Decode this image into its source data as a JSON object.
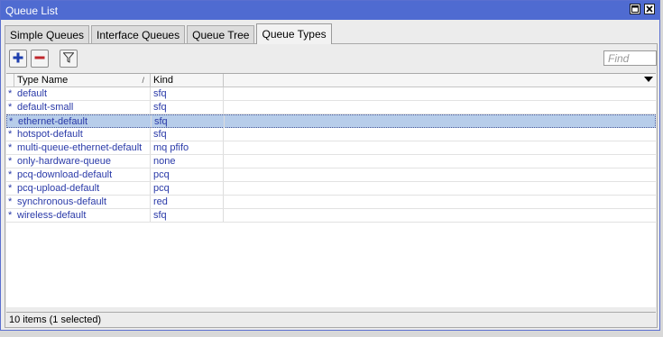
{
  "window": {
    "title": "Queue List"
  },
  "tabs": [
    {
      "label": "Simple Queues",
      "active": false
    },
    {
      "label": "Interface Queues",
      "active": false
    },
    {
      "label": "Queue Tree",
      "active": false
    },
    {
      "label": "Queue Types",
      "active": true
    }
  ],
  "toolbar": {
    "add_icon": "plus-icon",
    "remove_icon": "minus-icon",
    "filter_icon": "filter-icon",
    "find_placeholder": "Find"
  },
  "table": {
    "columns": [
      "Type Name",
      "Kind"
    ],
    "rows": [
      {
        "flag": "*",
        "name": "default",
        "kind": "sfq",
        "selected": false
      },
      {
        "flag": "*",
        "name": "default-small",
        "kind": "sfq",
        "selected": false
      },
      {
        "flag": "*",
        "name": "ethernet-default",
        "kind": "sfq",
        "selected": true
      },
      {
        "flag": "*",
        "name": "hotspot-default",
        "kind": "sfq",
        "selected": false
      },
      {
        "flag": "*",
        "name": "multi-queue-ethernet-default",
        "kind": "mq pfifo",
        "selected": false
      },
      {
        "flag": "*",
        "name": "only-hardware-queue",
        "kind": "none",
        "selected": false
      },
      {
        "flag": "*",
        "name": "pcq-download-default",
        "kind": "pcq",
        "selected": false
      },
      {
        "flag": "*",
        "name": "pcq-upload-default",
        "kind": "pcq",
        "selected": false
      },
      {
        "flag": "*",
        "name": "synchronous-default",
        "kind": "red",
        "selected": false
      },
      {
        "flag": "*",
        "name": "wireless-default",
        "kind": "sfq",
        "selected": false
      }
    ]
  },
  "status": {
    "text": "10 items (1 selected)"
  },
  "colors": {
    "titlebar": "#4f6bd1",
    "row_text": "#2a3aa8",
    "selected_row": "#b7cdea",
    "add_icon": "#1f3fae",
    "remove_icon": "#c0272d"
  }
}
